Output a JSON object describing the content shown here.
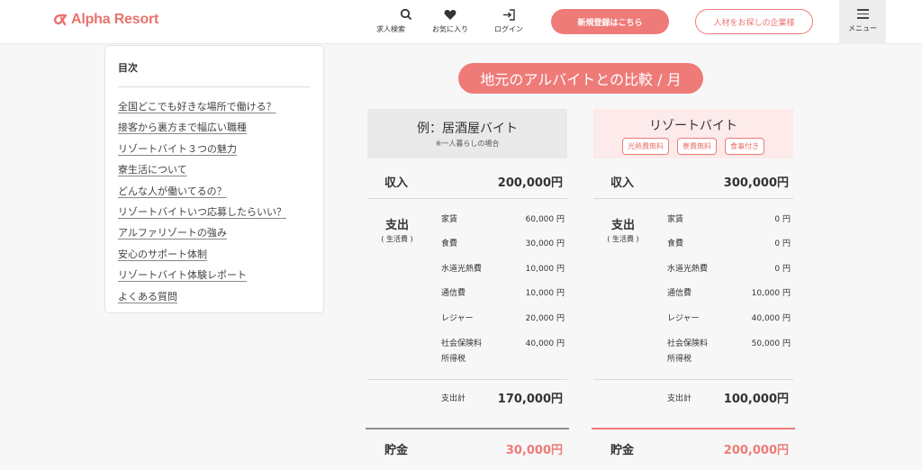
{
  "header": {
    "logo_text": "Alpha Resort",
    "brand_color": "#e8726d",
    "nav": {
      "search_label": "求人検索",
      "favorites_label": "お気に入り",
      "login_label": "ログイン"
    },
    "register_label": "新規登録はこちら",
    "company_label": "人材をお探しの企業様",
    "menu_label": "メニュー"
  },
  "toc": {
    "title": "目次",
    "items": [
      "全国どこでも好きな場所で働ける？",
      "接客から裏方まで幅広い職種",
      "リゾートバイト３つの魅力",
      "寮生活について",
      "どんな人が働いてるの？",
      "リゾートバイトいつ応募したらいい？",
      "アルファリゾートの強み",
      "安心のサポート体制",
      "リゾートバイト体験レポート",
      "よくある質問"
    ]
  },
  "comparison": {
    "title": "地元のアルバイトとの比較 / 月",
    "left": {
      "title": "例：居酒屋バイト",
      "subtitle": "※一人暮らしの場合",
      "income_label": "収入",
      "income_value": "200,000円",
      "expense_label": "支出",
      "expense_sub": "( 生活費 )",
      "expenses": [
        {
          "name": "家賃",
          "amount": "60,000 円"
        },
        {
          "name": "食費",
          "amount": "30,000 円"
        },
        {
          "name": "水道光熱費",
          "amount": "10,000 円"
        },
        {
          "name": "通信費",
          "amount": "10,000 円"
        },
        {
          "name": "レジャー",
          "amount": "20,000 円"
        },
        {
          "name": "社会保険料",
          "name2": "所得税",
          "amount": "40,000 円"
        }
      ],
      "subtotal_label": "支出計",
      "subtotal_value": "170,000円",
      "savings_label": "貯金",
      "savings_value": "30,000円"
    },
    "right": {
      "title": "リゾートバイト",
      "tags": [
        "光熱費無料",
        "寮費無料",
        "食事付き"
      ],
      "income_label": "収入",
      "income_value": "300,000円",
      "expense_label": "支出",
      "expense_sub": "( 生活費 )",
      "expenses": [
        {
          "name": "家賃",
          "amount": "0 円"
        },
        {
          "name": "食費",
          "amount": "0 円"
        },
        {
          "name": "水道光熱費",
          "amount": "0 円"
        },
        {
          "name": "通信費",
          "amount": "10,000 円"
        },
        {
          "name": "レジャー",
          "amount": "40,000 円"
        },
        {
          "name": "社会保険料",
          "name2": "所得税",
          "amount": "50,000 円"
        }
      ],
      "subtotal_label": "支出計",
      "subtotal_value": "100,000円",
      "savings_label": "貯金",
      "savings_value": "200,000円"
    }
  }
}
